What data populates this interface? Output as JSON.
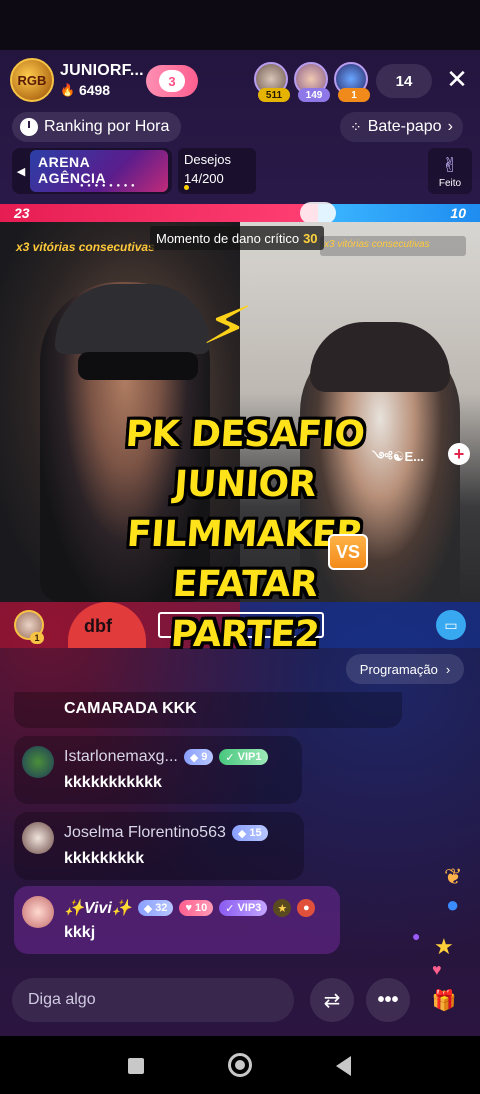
{
  "host": {
    "name": "JUNIORF...",
    "likes": "6498",
    "avatar_text": "RGB"
  },
  "follow": {
    "count": "3"
  },
  "viewers": [
    {
      "badge": "511",
      "badge_color": "#e5b400"
    },
    {
      "badge": "149",
      "badge_color": "#8e78e8"
    },
    {
      "badge": "1",
      "badge_color": "#f08a1a"
    }
  ],
  "viewer_count": "14",
  "ranking": {
    "label": "Ranking por Hora"
  },
  "chat_tab": {
    "label": "Bate-papo",
    "chevron": "›"
  },
  "arena": {
    "line1": "ARENA",
    "line2": "AGÊNCIA",
    "dots": "● ● ● ● ● ● ● ●"
  },
  "desejos": {
    "label": "Desejos",
    "value": "14/200"
  },
  "feito": {
    "label": "Feito"
  },
  "pk": {
    "left_score": "23",
    "right_score": "10",
    "red_ratio": 0.6625
  },
  "streak": {
    "left": "x3 vitórias consecutivas",
    "right": "x3 vitórias consecutivas"
  },
  "critical": {
    "label": "Momento de dano crítico",
    "value": "30"
  },
  "overlay_title": [
    "PK DESAFIO",
    "JUNIOR",
    "FILMMAKER",
    "EFATAR",
    "PARTE2"
  ],
  "vs_label": "VS",
  "right_user": "༺☯E...",
  "contrib": {
    "badge": "1",
    "logo": "dbf"
  },
  "program": {
    "label": "Programação",
    "chevron": "›"
  },
  "chat": {
    "cut_text": "CAMARADA KKK",
    "messages": [
      {
        "name": "Istarlonemaxg...",
        "level": "9",
        "vip": "VIP1",
        "text": "kkkkkkkkkkk"
      },
      {
        "name": "Joselma Florentino563",
        "level": "15",
        "text": "kkkkkkkkk"
      },
      {
        "name": "✨Vivi✨",
        "level": "32",
        "hearts": "10",
        "vip": "VIP3",
        "text": "kkkj"
      }
    ]
  },
  "input": {
    "placeholder": "Diga algo"
  },
  "colors": {
    "accent_red": "#ff3f73",
    "accent_blue": "#1f8cf0",
    "overlay_yellow": "#ffe21a"
  }
}
